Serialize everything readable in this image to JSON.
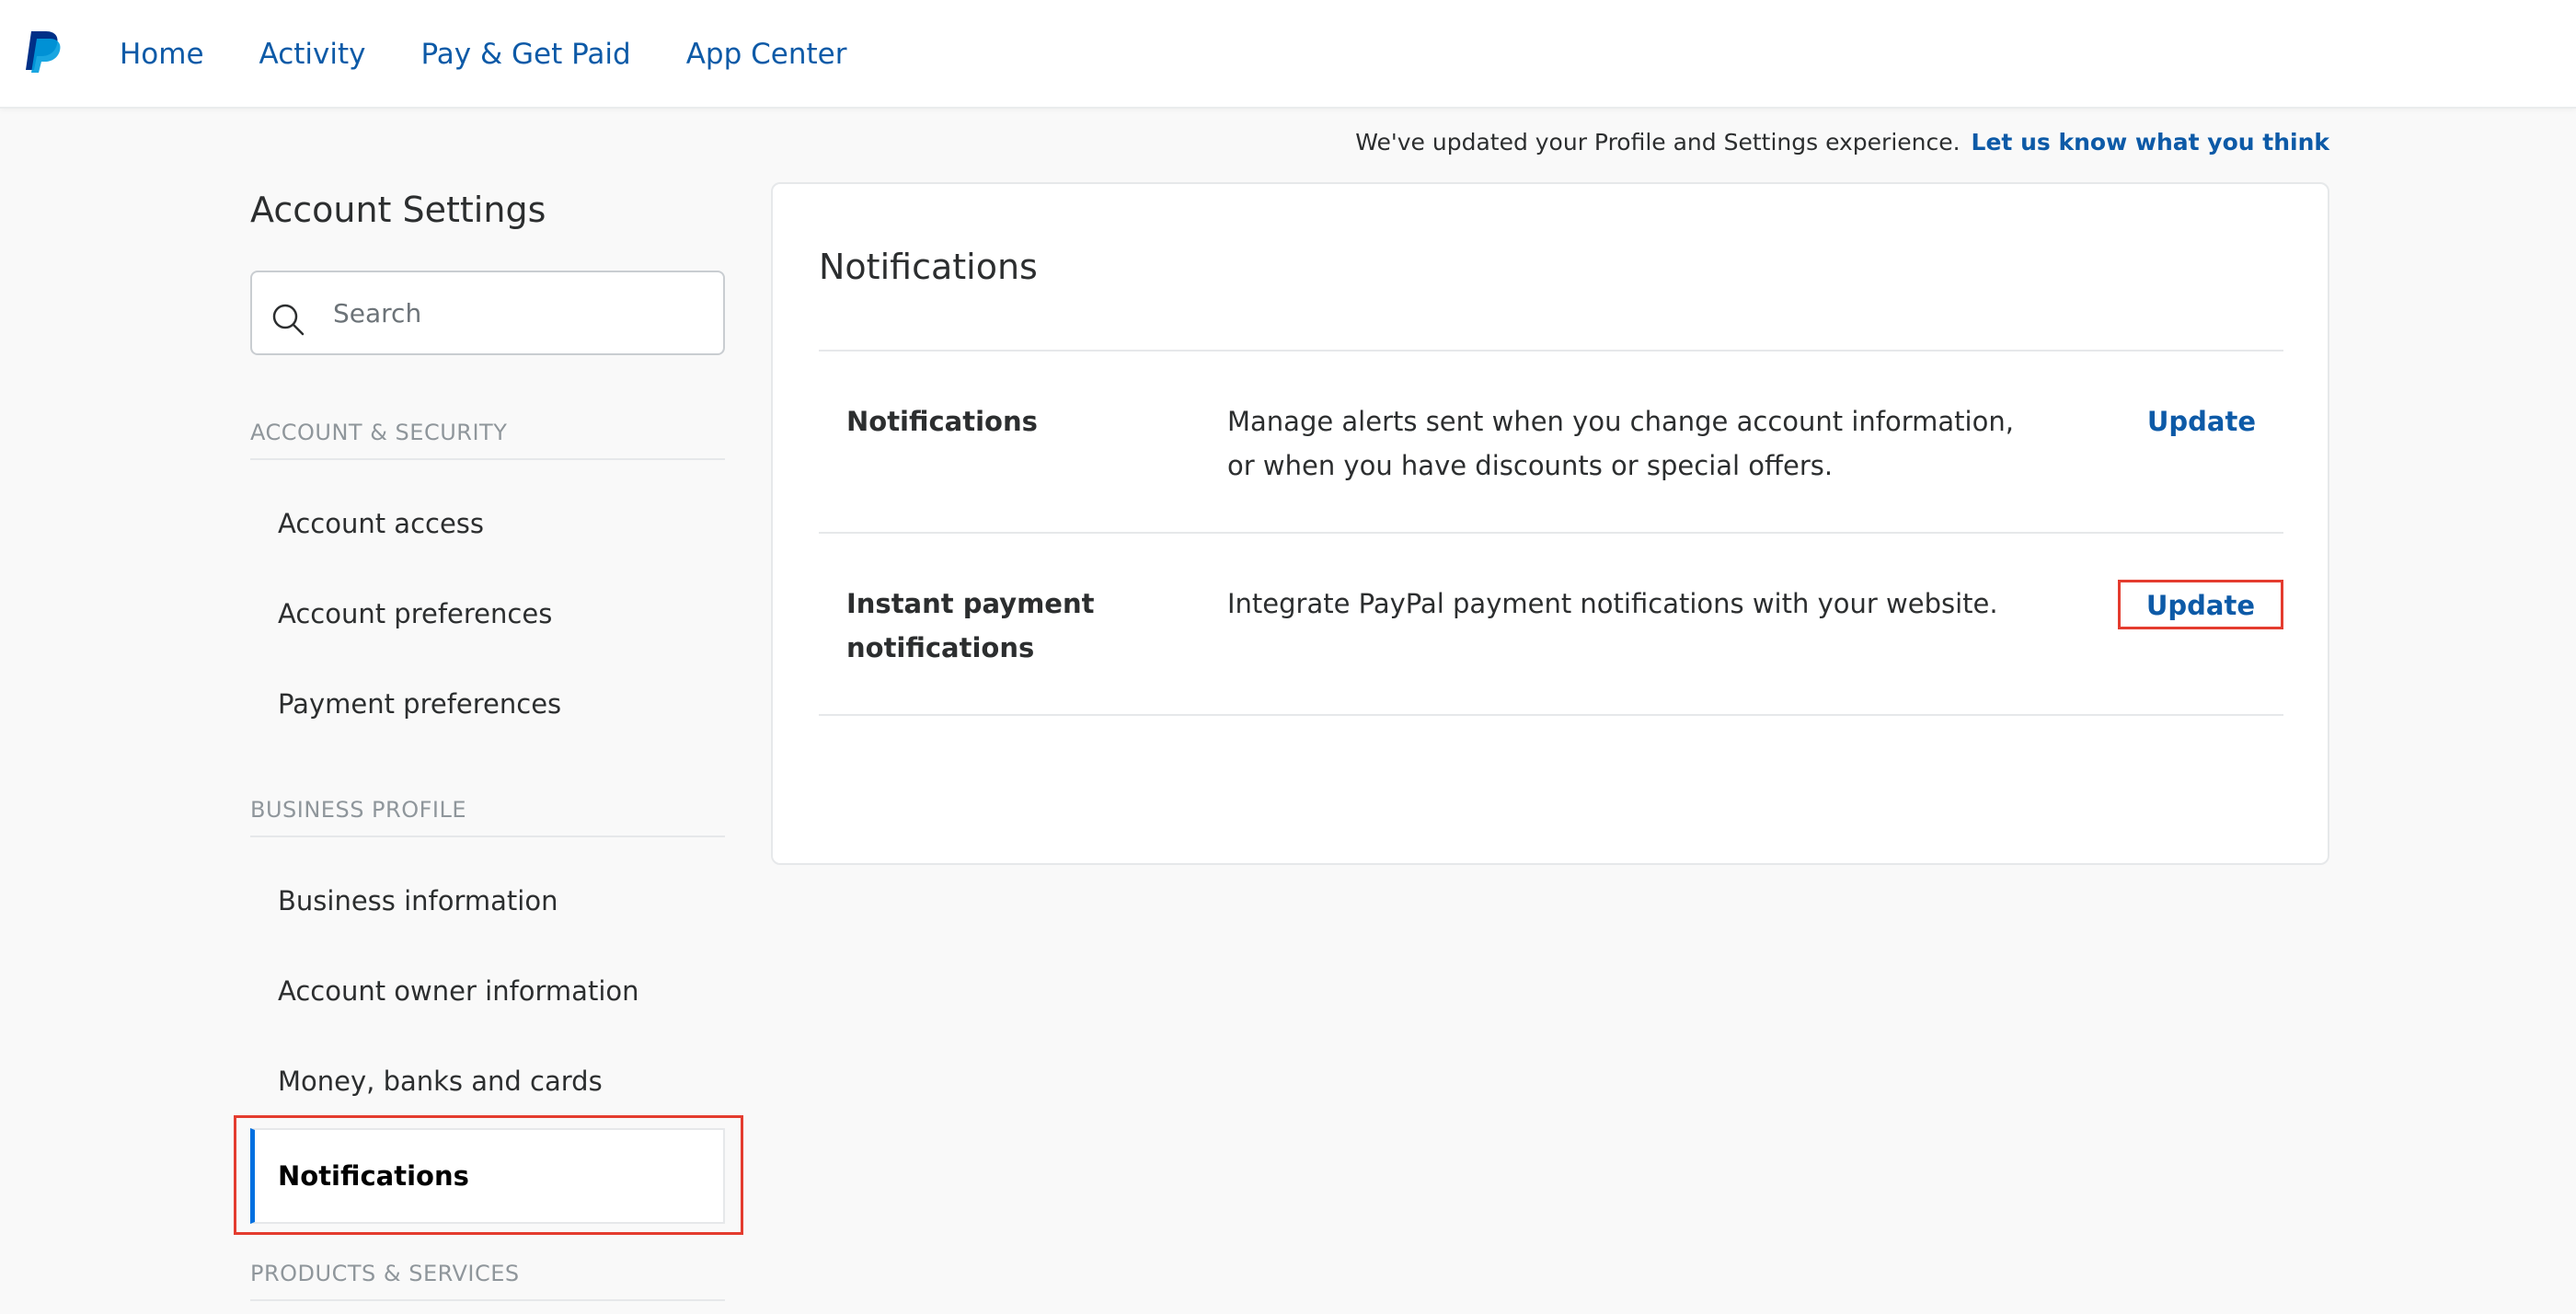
{
  "nav": {
    "items": [
      "Home",
      "Activity",
      "Pay & Get Paid",
      "App Center"
    ]
  },
  "feedback": {
    "text": "We've updated your Profile and Settings experience.",
    "link": "Let us know what you think"
  },
  "sidebar": {
    "title": "Account Settings",
    "search_placeholder": "Search",
    "sections": [
      {
        "label": "ACCOUNT & SECURITY",
        "items": [
          "Account access",
          "Account preferences",
          "Payment preferences"
        ]
      },
      {
        "label": "BUSINESS PROFILE",
        "items": [
          "Business information",
          "Account owner information",
          "Money, banks and cards"
        ],
        "active_item": "Notifications"
      },
      {
        "label": "PRODUCTS & SERVICES",
        "items": []
      }
    ]
  },
  "main": {
    "title": "Notifications",
    "rows": [
      {
        "name": "Notifications",
        "description": "Manage alerts sent when you change account information, or when you have discounts or special offers.",
        "action": "Update"
      },
      {
        "name": "Instant payment notifications",
        "description": "Integrate PayPal payment notifications with your website.",
        "action": "Update"
      }
    ]
  },
  "colors": {
    "link": "#0d5aa7",
    "active_indicator": "#0070e0",
    "highlight": "#e43c2f",
    "logo_dark": "#003087",
    "logo_light": "#009cde"
  }
}
